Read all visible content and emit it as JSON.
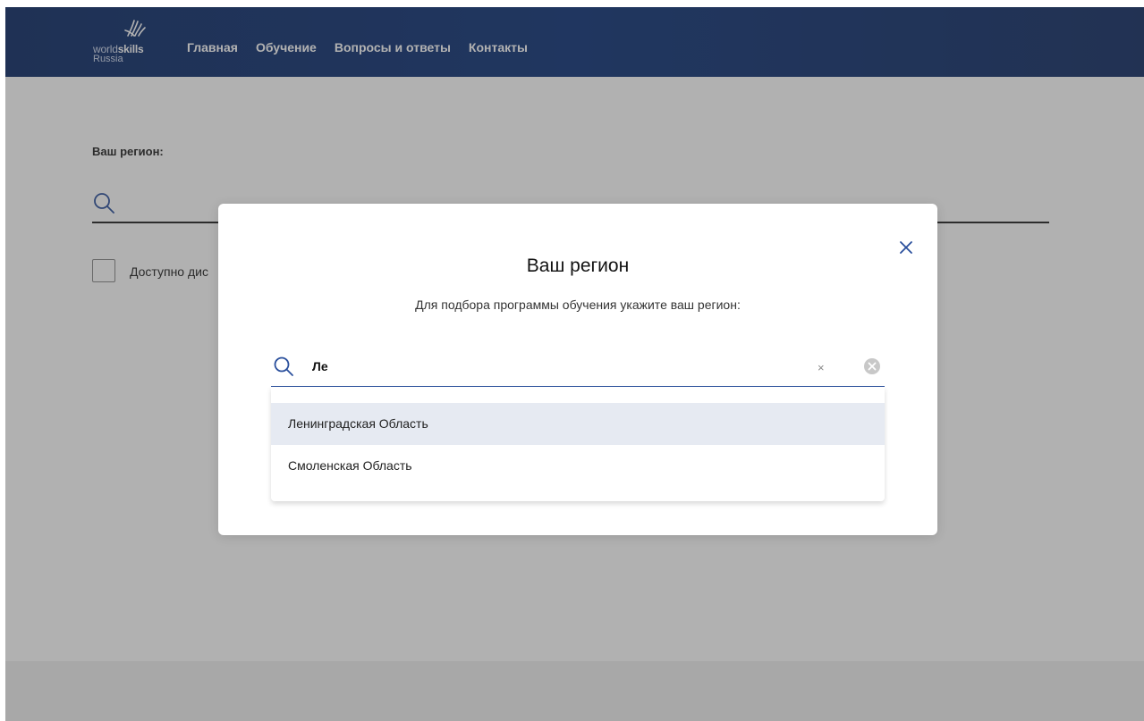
{
  "header": {
    "logo": {
      "line1_thin": "world",
      "line1_bold": "skills",
      "line2": "Russia"
    },
    "nav": [
      {
        "label": "Главная"
      },
      {
        "label": "Обучение"
      },
      {
        "label": "Вопросы и ответы"
      },
      {
        "label": "Контакты"
      }
    ]
  },
  "background": {
    "region_label": "Ваш регион:",
    "checkbox_label": "Доступно дис"
  },
  "modal": {
    "title": "Ваш регион",
    "subtitle": "Для подбора программы обучения укажите ваш регион:",
    "search": {
      "value": "Ле",
      "clear_small_glyph": "×"
    },
    "suggestions": [
      {
        "label": "Ленинградская Область",
        "active": true
      },
      {
        "label": "Смоленская Область",
        "active": false
      }
    ]
  },
  "colors": {
    "header_bg": "#0e3378",
    "accent": "#2a4f9c",
    "overlay": "rgba(60,60,60,0.4)",
    "suggestion_active_bg": "#e6eaf2"
  },
  "icons": {
    "logo_mark": "worldskills-hands-icon",
    "search": "search-icon",
    "close": "close-icon",
    "clear": "clear-circle-icon"
  }
}
